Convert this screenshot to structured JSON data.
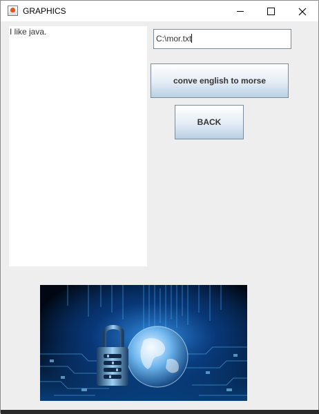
{
  "window": {
    "title": "GRAPHICS",
    "controls": {
      "minimize": "minimize-icon",
      "maximize": "maximize-icon",
      "close": "close-icon"
    }
  },
  "text_area": {
    "value": "I like java."
  },
  "path_field": {
    "value": "C:\\mor.txt"
  },
  "buttons": {
    "convert_label": "conve english to morse",
    "back_label": "BACK"
  },
  "image": {
    "subject": "padlock-and-globe-on-circuit-board"
  },
  "colors": {
    "window_bg": "#eeeeee",
    "button_gradient_top": "#ffffff",
    "button_gradient_bottom": "#b8cfe5",
    "image_accent": "#1f8fff"
  }
}
